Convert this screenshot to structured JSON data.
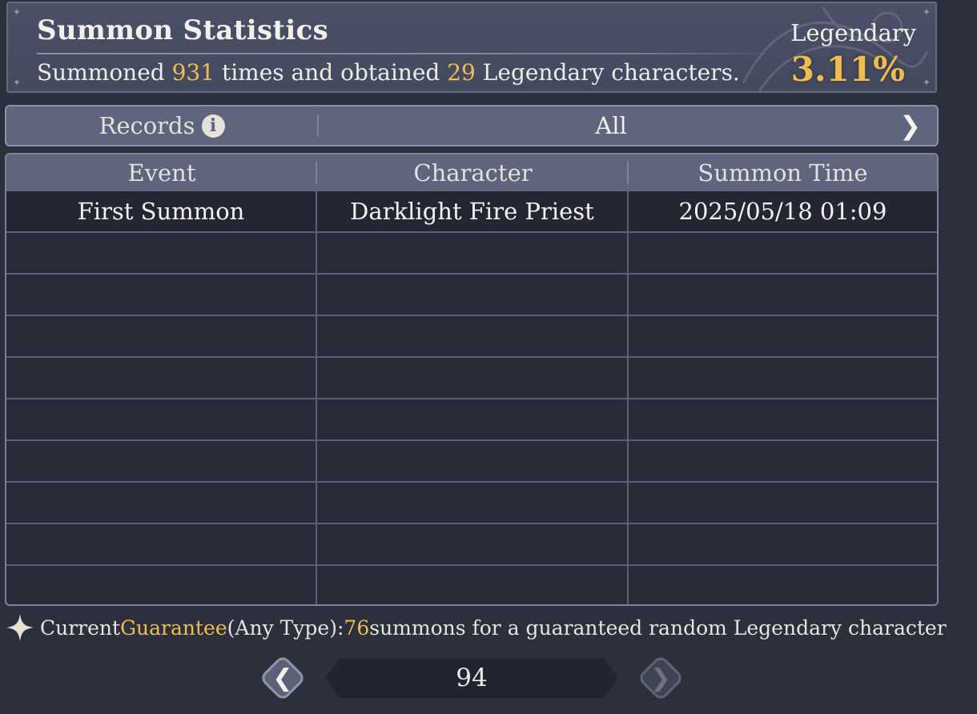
{
  "header": {
    "title": "Summon Statistics",
    "summary_prefix": "Summoned ",
    "summon_count": "931",
    "summary_mid": " times and obtained ",
    "legendary_count": "29",
    "summary_suffix": " Legendary characters.",
    "rate_label": "Legendary",
    "rate_value": "3.11%"
  },
  "filter": {
    "records_label": "Records",
    "value": "All"
  },
  "table": {
    "columns": [
      "Event",
      "Character",
      "Summon Time"
    ],
    "rows": [
      [
        "First Summon",
        "Darklight Fire Priest",
        "2025/05/18 01:09"
      ],
      [
        "",
        "",
        ""
      ],
      [
        "",
        "",
        ""
      ],
      [
        "",
        "",
        ""
      ],
      [
        "",
        "",
        ""
      ],
      [
        "",
        "",
        ""
      ],
      [
        "",
        "",
        ""
      ],
      [
        "",
        "",
        ""
      ],
      [
        "",
        "",
        ""
      ],
      [
        "",
        "",
        ""
      ]
    ]
  },
  "note": {
    "prefix": "Current ",
    "guarantee": "Guarantee",
    "type": " (Any Type): ",
    "count": "76",
    "suffix": " summons for a guaranteed random Legendary character"
  },
  "pager": {
    "page": "94"
  },
  "colors": {
    "accent_gold": "#f1bc4f",
    "background": "#2c303d",
    "header_bar": "#5f657d"
  },
  "icons": {
    "info": "info-icon",
    "filter_next": "chevron-right-icon",
    "note": "sparkle-icon",
    "prev": "chevron-left-icon",
    "next": "chevron-right-icon"
  }
}
